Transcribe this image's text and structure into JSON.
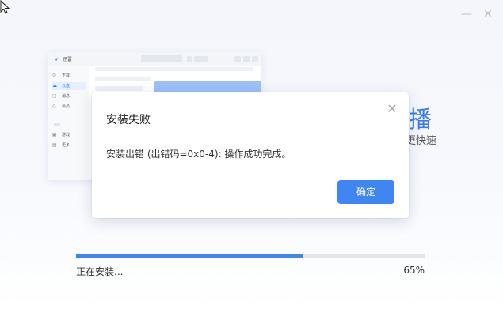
{
  "window": {
    "minimize_glyph": "—",
    "close_glyph": "✕"
  },
  "preview": {
    "app_name": "迅雷",
    "sidebar": [
      {
        "icon": "download-icon",
        "label": "下载",
        "active": false
      },
      {
        "icon": "cloud-icon",
        "label": "云盘",
        "active": true
      },
      {
        "icon": "message-icon",
        "label": "消息",
        "active": false
      },
      {
        "icon": "member-icon",
        "label": "会员",
        "active": false
      },
      {
        "icon": "game-icon",
        "label": "游戏",
        "active": false
      },
      {
        "icon": "more-icon",
        "label": "更多",
        "active": false
      }
    ]
  },
  "background_promo": {
    "headline": "播",
    "subline": "更快速"
  },
  "dialog": {
    "title": "安装失败",
    "message": "安装出错 (出错码=0x0-4): 操作成功完成。",
    "close_glyph": "✕",
    "ok_label": "确定"
  },
  "install": {
    "status": "正在安装...",
    "progress_percent": 65,
    "progress_label": "65%"
  },
  "colors": {
    "accent": "#3f86f3",
    "track": "#e4e6eb",
    "background": "#f6f8fc"
  }
}
